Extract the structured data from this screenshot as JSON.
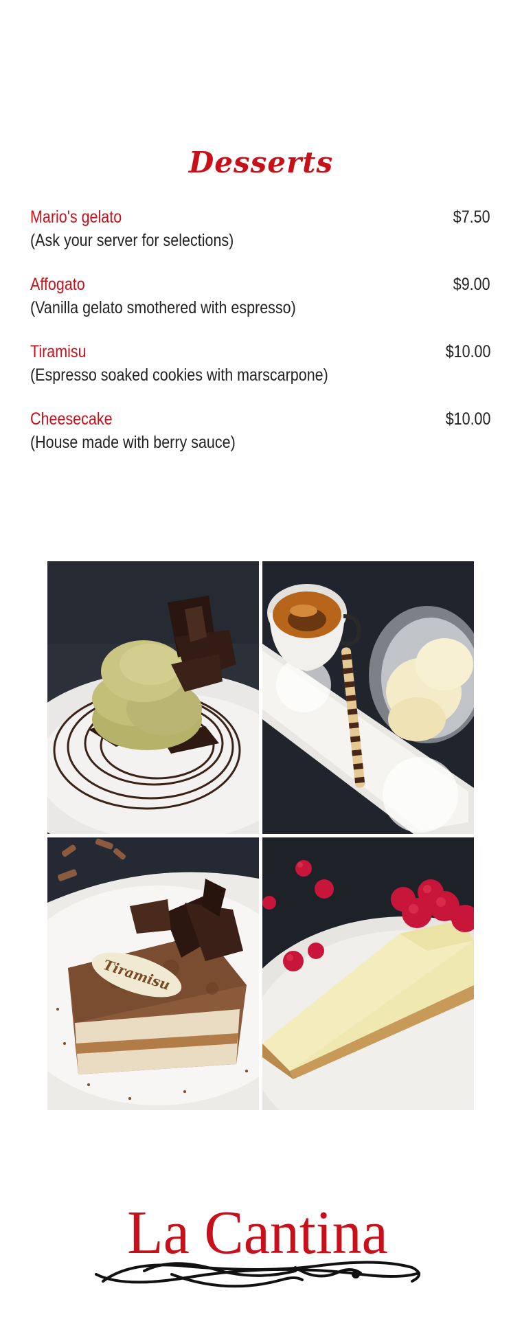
{
  "title": "Desserts",
  "items": [
    {
      "name": "Mario's gelato",
      "price": "$7.50",
      "description": "(Ask your server for selections)"
    },
    {
      "name": "Affogato",
      "price": "$9.00",
      "description": "(Vanilla gelato smothered with espresso)"
    },
    {
      "name": "Tiramisu",
      "price": "$10.00",
      "description": "(Espresso soaked cookies with marscarpone)"
    },
    {
      "name": "Cheesecake",
      "price": "$10.00",
      "description": "(House made with berry sauce)"
    }
  ],
  "photos": [
    {
      "subject": "pistachio gelato with chocolate curls"
    },
    {
      "subject": "affogato with espresso cup and vanilla gelato"
    },
    {
      "subject": "tiramisu with chocolate plaque",
      "plaque_text": "Tiramisu"
    },
    {
      "subject": "cheesecake slice with raspberries"
    }
  ],
  "logo": {
    "text": "La Cantina"
  },
  "colors": {
    "accent": "#c8101a",
    "text": "#222222",
    "background": "#ffffff"
  }
}
